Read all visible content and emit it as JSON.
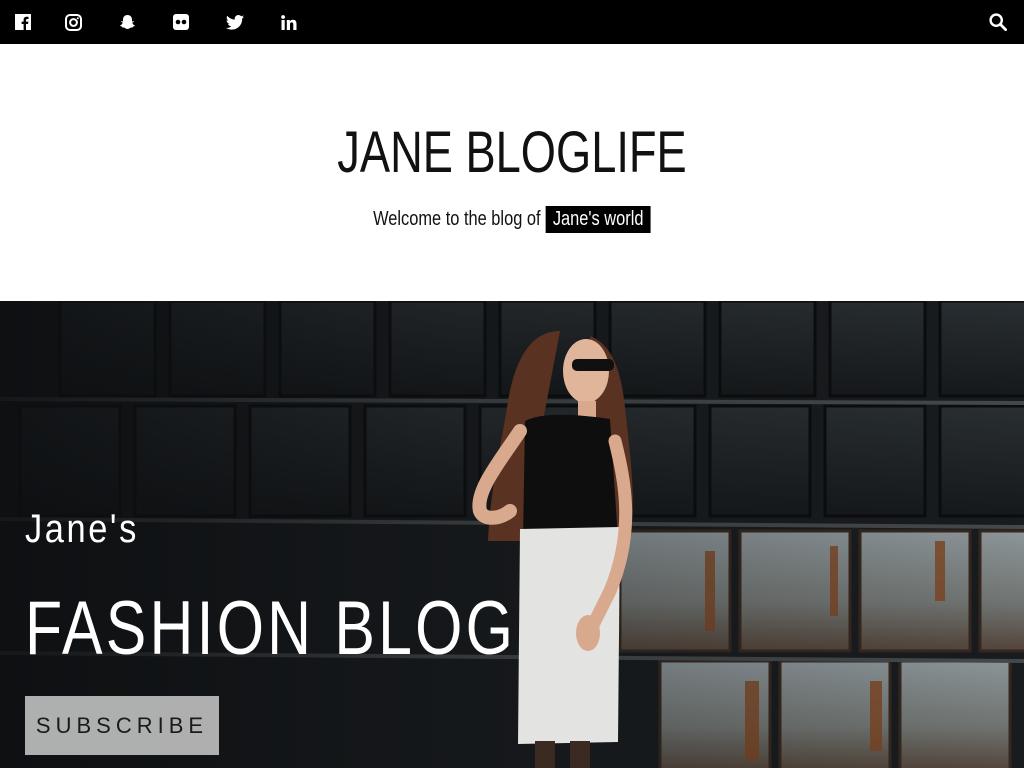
{
  "topbar": {
    "social": [
      {
        "icon": "facebook-icon"
      },
      {
        "icon": "instagram-icon"
      },
      {
        "icon": "snapchat-icon"
      },
      {
        "icon": "flickr-icon"
      },
      {
        "icon": "twitter-icon"
      },
      {
        "icon": "linkedin-icon"
      }
    ],
    "search_icon": "search-icon"
  },
  "header": {
    "title": "JANE BLOGLIFE",
    "tagline_prefix": "Welcome to the blog of",
    "tagline_highlight": "Jane's world"
  },
  "hero": {
    "pretitle": "Jane's",
    "title": "FASHION BLOG",
    "button_label": "SUBSCRIBE"
  },
  "colors": {
    "topbar_bg": "#000000",
    "highlight_bg": "#000000",
    "hero_text": "#ffffff"
  }
}
